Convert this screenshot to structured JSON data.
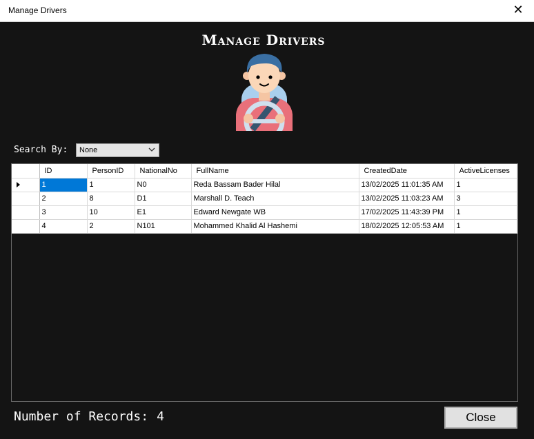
{
  "window": {
    "title": "Manage Drivers",
    "close_glyph": "✕"
  },
  "header": {
    "heading": "Manage Drivers",
    "icon": "driver-avatar-icon"
  },
  "search": {
    "label": "Search By:",
    "selected": "None"
  },
  "grid": {
    "columns": [
      "ID",
      "PersonID",
      "NationalNo",
      "FullName",
      "CreatedDate",
      "ActiveLicenses"
    ],
    "rows": [
      {
        "id": "1",
        "person_id": "1",
        "national_no": "N0",
        "full_name": "Reda Bassam Bader Hilal",
        "created_date": "13/02/2025 11:01:35 AM",
        "active_licenses": "1"
      },
      {
        "id": "2",
        "person_id": "8",
        "national_no": "D1",
        "full_name": "Marshall D. Teach",
        "created_date": "13/02/2025 11:03:23 AM",
        "active_licenses": "3"
      },
      {
        "id": "3",
        "person_id": "10",
        "national_no": "E1",
        "full_name": "Edward  Newgate WB",
        "created_date": "17/02/2025 11:43:39 PM",
        "active_licenses": "1"
      },
      {
        "id": "4",
        "person_id": "2",
        "national_no": "N101",
        "full_name": "Mohammed Khalid Al Hashemi",
        "created_date": "18/02/2025 12:05:53 AM",
        "active_licenses": "1"
      }
    ]
  },
  "footer": {
    "records_label": "Number of Records:",
    "records_count": "4",
    "close_label": "Close"
  },
  "colors": {
    "background": "#141414",
    "selection": "#0078d7"
  }
}
